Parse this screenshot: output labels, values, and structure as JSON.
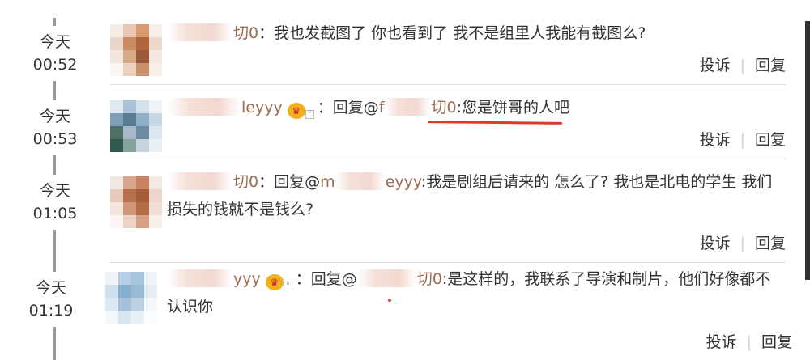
{
  "colors": {
    "nickname": "#9b6b52",
    "highlight_underline": "#d93a2b",
    "divider": "#e0e0e0",
    "timeline": "#9a9a9a"
  },
  "actions": {
    "report": "投诉",
    "reply": "回复"
  },
  "comments": [
    {
      "time_day": "今天",
      "time_clock": "00:52",
      "nick_suffix": "切0",
      "colon": "：",
      "body": "我也发截图了 你也看到了 我不是组里人我能有截图么?"
    },
    {
      "time_day": "今天",
      "time_clock": "00:53",
      "nick_suffix": "leyyy",
      "colon": "：",
      "reply_prefix": "回复@",
      "mention_prefix": "f",
      "mention_suffix": "切0",
      "body": ":您是饼哥的人吧"
    },
    {
      "time_day": "今天",
      "time_clock": "01:05",
      "nick_suffix": "切0",
      "colon": "：",
      "reply_prefix": "回复@",
      "mention_prefix": "m",
      "mention_suffix": "eyyy",
      "body_line1": ":我是剧组后请来的 怎么了? 我也是北电的学生 我们",
      "body_line2": "损失的钱就不是钱么?"
    },
    {
      "time_day": "今天",
      "time_clock": "01:19",
      "nick_suffix": "yyy",
      "colon": "：",
      "reply_prefix": "回复@",
      "mention_suffix": "切0",
      "body_line1": ":是这样的，我联系了导演和制片，他们好像都不",
      "body_line2": "认识你"
    }
  ]
}
